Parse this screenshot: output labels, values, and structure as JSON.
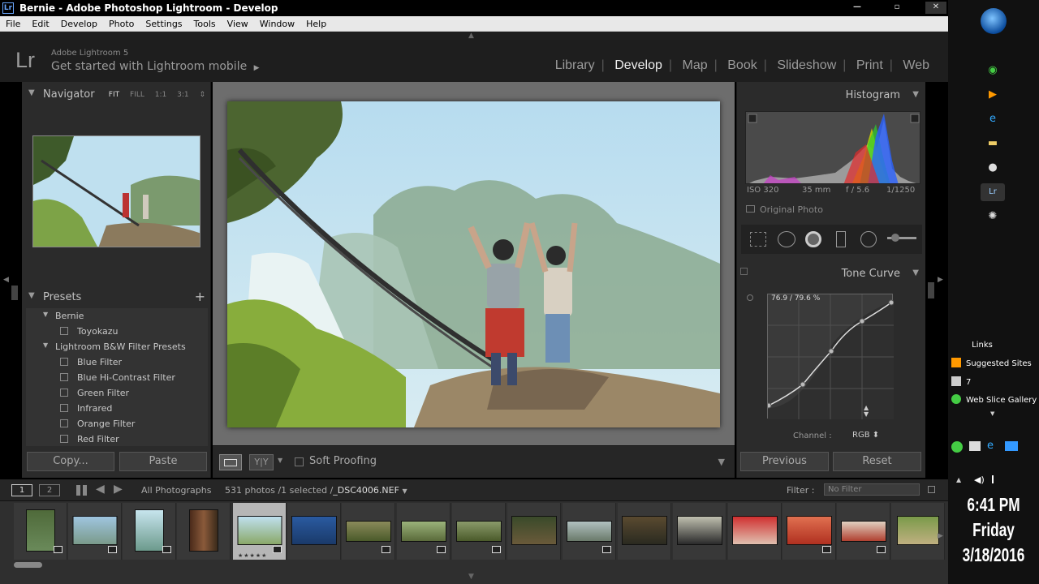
{
  "window": {
    "title": "Bernie - Adobe Photoshop Lightroom - Develop",
    "minimize": "—",
    "maximize": "▫",
    "close": "✕"
  },
  "menubar": [
    "File",
    "Edit",
    "Develop",
    "Photo",
    "Settings",
    "Tools",
    "View",
    "Window",
    "Help"
  ],
  "identity": {
    "logo": "Lr",
    "version": "Adobe Lightroom 5",
    "tagline": "Get started with Lightroom mobile",
    "tagline_arrow": "▶"
  },
  "modules": [
    {
      "label": "Library",
      "active": false
    },
    {
      "label": "Develop",
      "active": true
    },
    {
      "label": "Map",
      "active": false
    },
    {
      "label": "Book",
      "active": false
    },
    {
      "label": "Slideshow",
      "active": false
    },
    {
      "label": "Print",
      "active": false
    },
    {
      "label": "Web",
      "active": false
    }
  ],
  "module_separator": "|",
  "navigator": {
    "title": "Navigator",
    "options": [
      "FIT",
      "FILL",
      "1:1",
      "3:1"
    ],
    "options_more": "⇕"
  },
  "presets": {
    "title": "Presets",
    "add": "+",
    "items": [
      {
        "label": "Bernie",
        "type": "folder"
      },
      {
        "label": "Toyokazu",
        "type": "preset"
      },
      {
        "label": "Lightroom B&W Filter Presets",
        "type": "folder"
      },
      {
        "label": "Blue Filter",
        "type": "preset"
      },
      {
        "label": "Blue Hi-Contrast Filter",
        "type": "preset"
      },
      {
        "label": "Green Filter",
        "type": "preset"
      },
      {
        "label": "Infrared",
        "type": "preset"
      },
      {
        "label": "Orange Filter",
        "type": "preset"
      },
      {
        "label": "Red Filter",
        "type": "preset"
      }
    ]
  },
  "left_buttons": {
    "copy": "Copy...",
    "paste": "Paste"
  },
  "toolbar": {
    "view_mode": "Y|Y",
    "soft_proofing": "Soft Proofing",
    "dropdown": "▼"
  },
  "histogram": {
    "title": "Histogram",
    "iso": "ISO 320",
    "focal": "35 mm",
    "aperture": "f / 5.6",
    "shutter": "1/1250",
    "original_photo": "Original Photo"
  },
  "tone_curve": {
    "title": "Tone Curve",
    "readout": "76.9 / 79.6 %",
    "channel_label": "Channel :",
    "channel_value": "RGB ⬍"
  },
  "right_buttons": {
    "previous": "Previous",
    "reset": "Reset"
  },
  "filmbar": {
    "screen1": "1",
    "screen2": "2",
    "source": "All Photographs",
    "count": "531 photos /1 selected /",
    "filename": "_DSC4006.NEF",
    "filter_label": "Filter :",
    "filter_value": "No Filter"
  },
  "film_stars": "★★★★★",
  "winbar": {
    "links_title": "Links",
    "links": [
      "Suggested Sites",
      "7",
      "Web Slice Gallery"
    ],
    "time": "6:41 PM",
    "day": "Friday",
    "date": "3/18/2016"
  },
  "panel_collapse": "▼",
  "panel_expand": "▶"
}
